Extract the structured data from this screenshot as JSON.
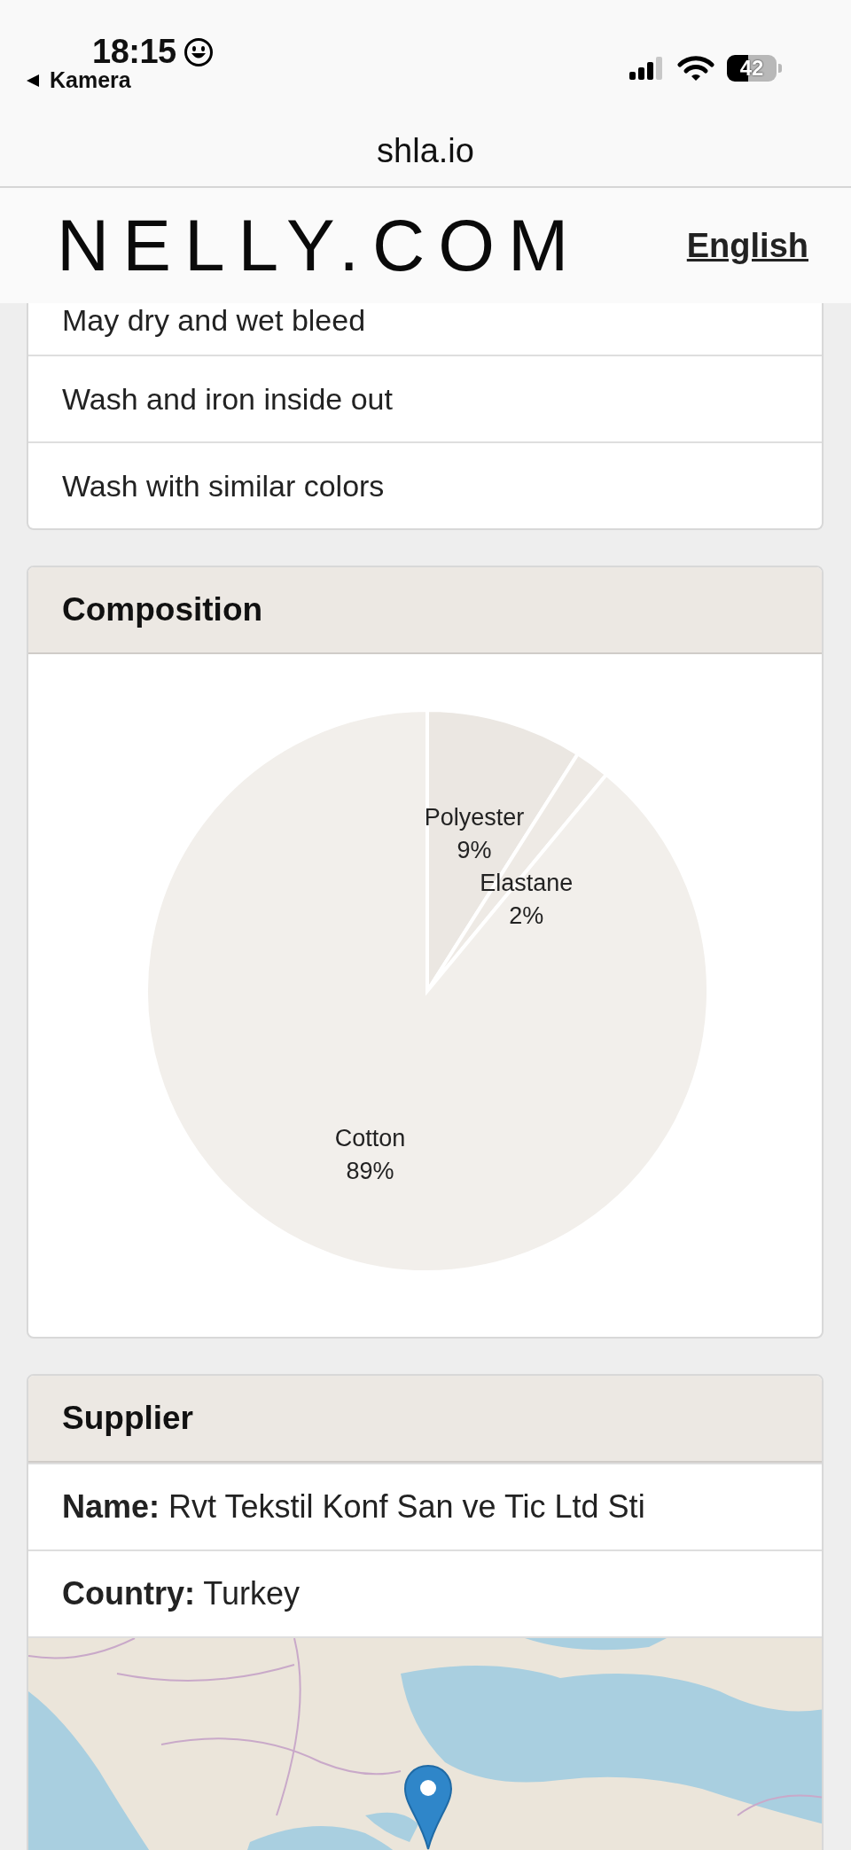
{
  "status_bar": {
    "time": "18:15",
    "back_label": "Kamera",
    "battery": "42"
  },
  "browser": {
    "url": "shla.io"
  },
  "header": {
    "logo": "NELLY.COM",
    "language_link": "English"
  },
  "care_instructions": {
    "items": [
      "May dry and wet bleed",
      "Wash and iron inside out",
      "Wash with similar colors"
    ]
  },
  "composition": {
    "title": "Composition",
    "chart_data": {
      "type": "pie",
      "categories": [
        "Polyester",
        "Elastane",
        "Cotton"
      ],
      "values": [
        9,
        2,
        89
      ],
      "value_labels": [
        "9%",
        "2%",
        "89%"
      ]
    }
  },
  "supplier": {
    "title": "Supplier",
    "fields": [
      {
        "label": "Name:",
        "value": "Rvt Tekstil Konf San ve Tic Ltd Sti"
      },
      {
        "label": "Country:",
        "value": "Turkey"
      }
    ]
  }
}
